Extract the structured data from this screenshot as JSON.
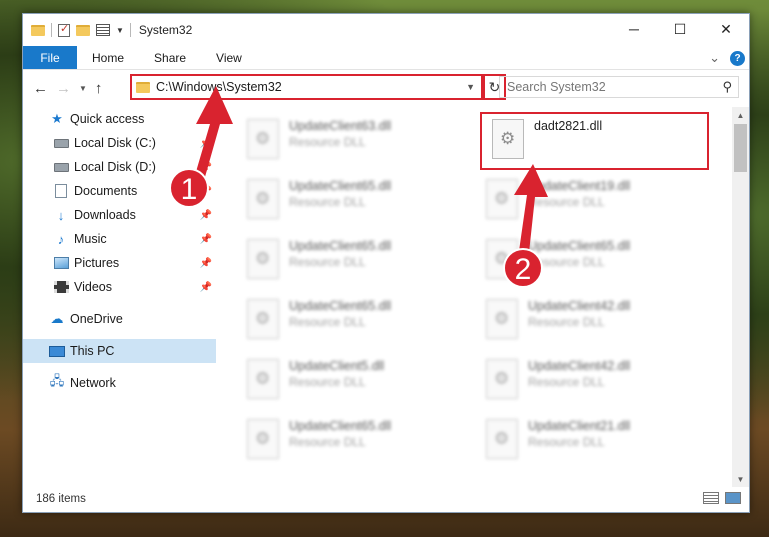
{
  "window": {
    "title": "System32",
    "caption": {
      "minimize": "─",
      "maximize": "☐",
      "close": "✕"
    }
  },
  "ribbon": {
    "tabs": [
      "File",
      "Home",
      "Share",
      "View"
    ],
    "expand_icon": "⌄",
    "help": "?"
  },
  "address": {
    "path": "C:\\Windows\\System32",
    "search_placeholder": "Search System32"
  },
  "sidebar": {
    "items": [
      {
        "label": "Quick access",
        "icon": "star-icon",
        "pinned": false
      },
      {
        "label": "Local Disk (C:)",
        "icon": "disk-icon",
        "pinned": true
      },
      {
        "label": "Local Disk (D:)",
        "icon": "disk-icon",
        "pinned": true
      },
      {
        "label": "Documents",
        "icon": "documents-icon",
        "pinned": true
      },
      {
        "label": "Downloads",
        "icon": "downloads-icon",
        "pinned": true
      },
      {
        "label": "Music",
        "icon": "music-icon",
        "pinned": true
      },
      {
        "label": "Pictures",
        "icon": "pictures-icon",
        "pinned": true
      },
      {
        "label": "Videos",
        "icon": "videos-icon",
        "pinned": true
      },
      {
        "label": "OneDrive",
        "icon": "onedrive-icon",
        "pinned": false
      },
      {
        "label": "This PC",
        "icon": "this-pc-icon",
        "pinned": false,
        "selected": true
      },
      {
        "label": "Network",
        "icon": "network-icon",
        "pinned": false
      }
    ]
  },
  "files": {
    "left_column": [
      {
        "name": "UpdateClient63.dll",
        "type": "Resource DLL"
      },
      {
        "name": "UpdateClient65.dll",
        "type": "Resource DLL"
      },
      {
        "name": "UpdateClient65.dll",
        "type": "Resource DLL"
      },
      {
        "name": "UpdateClient65.dll",
        "type": "Resource DLL"
      },
      {
        "name": "UpdateClient5.dll",
        "type": "Resource DLL"
      },
      {
        "name": "UpdateClient65.dll",
        "type": "Resource DLL"
      }
    ],
    "right_column": [
      {
        "name": "dadt2821.dll",
        "type": "",
        "highlighted": true
      },
      {
        "name": "UpdateClient19.dll",
        "type": "Resource DLL"
      },
      {
        "name": "UpdateClient65.dll",
        "type": "Resource DLL"
      },
      {
        "name": "UpdateClient42.dll",
        "type": "Resource DLL"
      },
      {
        "name": "UpdateClient42.dll",
        "type": "Resource DLL"
      },
      {
        "name": "UpdateClient21.dll",
        "type": "Resource DLL"
      }
    ]
  },
  "status": {
    "item_count": "186 items"
  },
  "annotations": {
    "step1": "1",
    "step2": "2",
    "accent_color": "#d9232f"
  }
}
